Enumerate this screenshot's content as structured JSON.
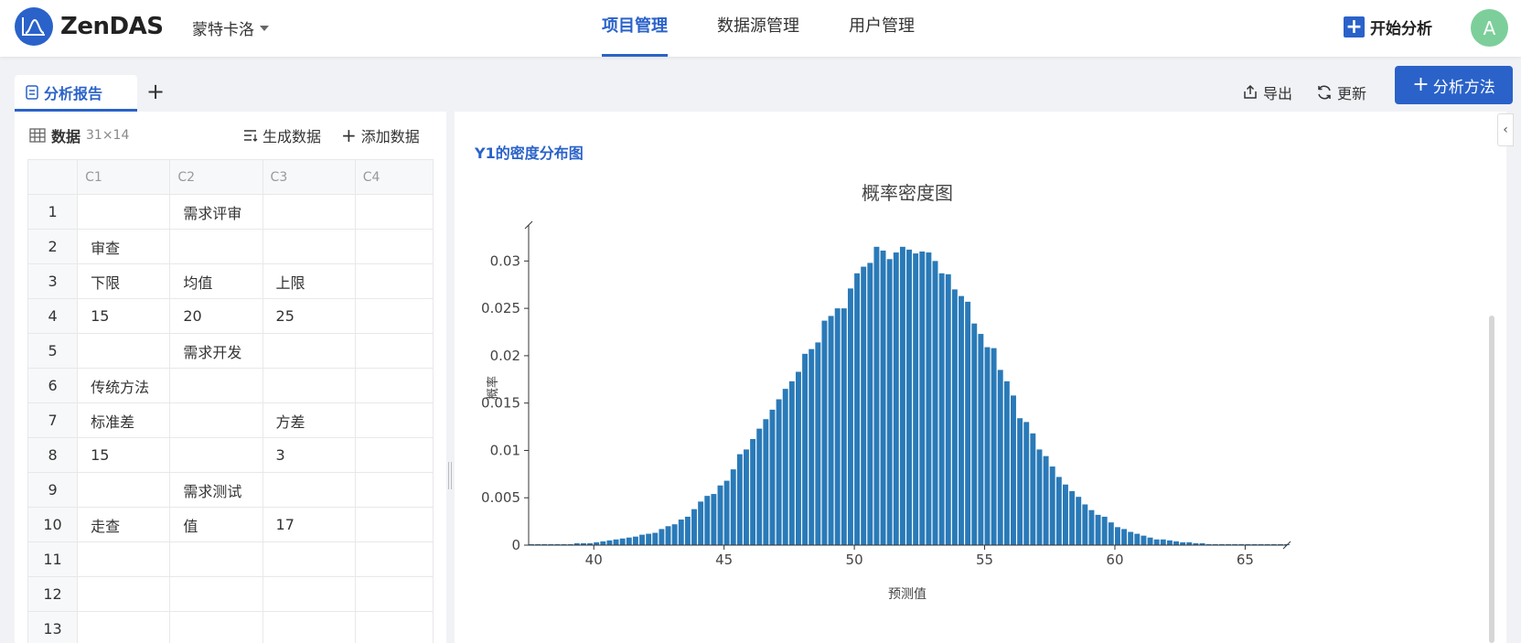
{
  "header": {
    "brand": "ZenDAS",
    "project": "蒙特卡洛",
    "nav": [
      "项目管理",
      "数据源管理",
      "用户管理"
    ],
    "start_analysis": "开始分析",
    "avatar_letter": "A"
  },
  "tabs": {
    "active_label": "分析报告"
  },
  "toolbar": {
    "export": "导出",
    "refresh": "更新",
    "add_method": "分析方法"
  },
  "data_panel": {
    "title": "数据",
    "dims": "31×14",
    "generate": "生成数据",
    "add": "添加数据",
    "columns": [
      "C1",
      "C2",
      "C3",
      "C4"
    ],
    "rows": [
      [
        "",
        "需求评审",
        "",
        ""
      ],
      [
        "审查",
        "",
        "",
        ""
      ],
      [
        "下限",
        "均值",
        "上限",
        ""
      ],
      [
        "15",
        "20",
        "25",
        ""
      ],
      [
        "",
        "需求开发",
        "",
        ""
      ],
      [
        "传统方法",
        "",
        "",
        ""
      ],
      [
        "标准差",
        "",
        "方差",
        ""
      ],
      [
        "15",
        "",
        "3",
        ""
      ],
      [
        "",
        "需求测试",
        "",
        ""
      ],
      [
        "走查",
        "值",
        "17",
        ""
      ],
      [
        "",
        "",
        "",
        ""
      ],
      [
        "",
        "",
        "",
        ""
      ],
      [
        "",
        "",
        "",
        ""
      ]
    ]
  },
  "report": {
    "section_title": "Y1的密度分布图"
  },
  "chart_data": {
    "type": "bar",
    "title": "概率密度图",
    "xlabel": "预测值",
    "ylabel": "概率",
    "xlim": [
      37.5,
      66.6
    ],
    "ylim": [
      0,
      0.0338
    ],
    "xticks": [
      40,
      45,
      50,
      55,
      60,
      65
    ],
    "yticks": [
      0,
      0.005,
      0.01,
      0.015,
      0.02,
      0.025,
      0.03
    ],
    "ytick_labels": [
      "0",
      "0.005",
      "0.01",
      "0.015",
      "0.02",
      "0.025",
      "0.03"
    ],
    "bar_color": "#2a7ab8",
    "bin_width": 0.25,
    "x_start": 37.5,
    "values": [
      0.0001,
      0.0001,
      0.0001,
      0.0001,
      0.0001,
      0.0001,
      0.0001,
      0.0002,
      0.0002,
      0.0002,
      0.0003,
      0.0004,
      0.0005,
      0.0006,
      0.0007,
      0.0008,
      0.0009,
      0.0011,
      0.0012,
      0.0013,
      0.0017,
      0.002,
      0.0022,
      0.0027,
      0.003,
      0.0038,
      0.0046,
      0.0052,
      0.0054,
      0.0063,
      0.0068,
      0.008,
      0.0096,
      0.0101,
      0.0112,
      0.0123,
      0.0133,
      0.0143,
      0.0154,
      0.0165,
      0.0173,
      0.0183,
      0.0202,
      0.0207,
      0.0214,
      0.0237,
      0.0242,
      0.025,
      0.025,
      0.0271,
      0.0287,
      0.0294,
      0.0298,
      0.0315,
      0.0311,
      0.0302,
      0.0309,
      0.0315,
      0.0312,
      0.0308,
      0.031,
      0.0309,
      0.03,
      0.0287,
      0.0286,
      0.027,
      0.0263,
      0.0257,
      0.0234,
      0.0223,
      0.0209,
      0.0208,
      0.0185,
      0.0173,
      0.0158,
      0.0134,
      0.013,
      0.0118,
      0.0101,
      0.0094,
      0.0083,
      0.0072,
      0.0064,
      0.0057,
      0.0051,
      0.0043,
      0.0037,
      0.0032,
      0.003,
      0.0024,
      0.0019,
      0.0017,
      0.0014,
      0.0012,
      0.001,
      0.0008,
      0.0006,
      0.0006,
      0.0005,
      0.0004,
      0.0003,
      0.0003,
      0.0002,
      0.0002,
      0.0001,
      0.0001,
      0.0001,
      0.0001,
      0.0001,
      0.0001,
      0.0001,
      0.0001,
      0.0001,
      0.0001,
      0.0001,
      0.0001,
      0.0001
    ]
  }
}
